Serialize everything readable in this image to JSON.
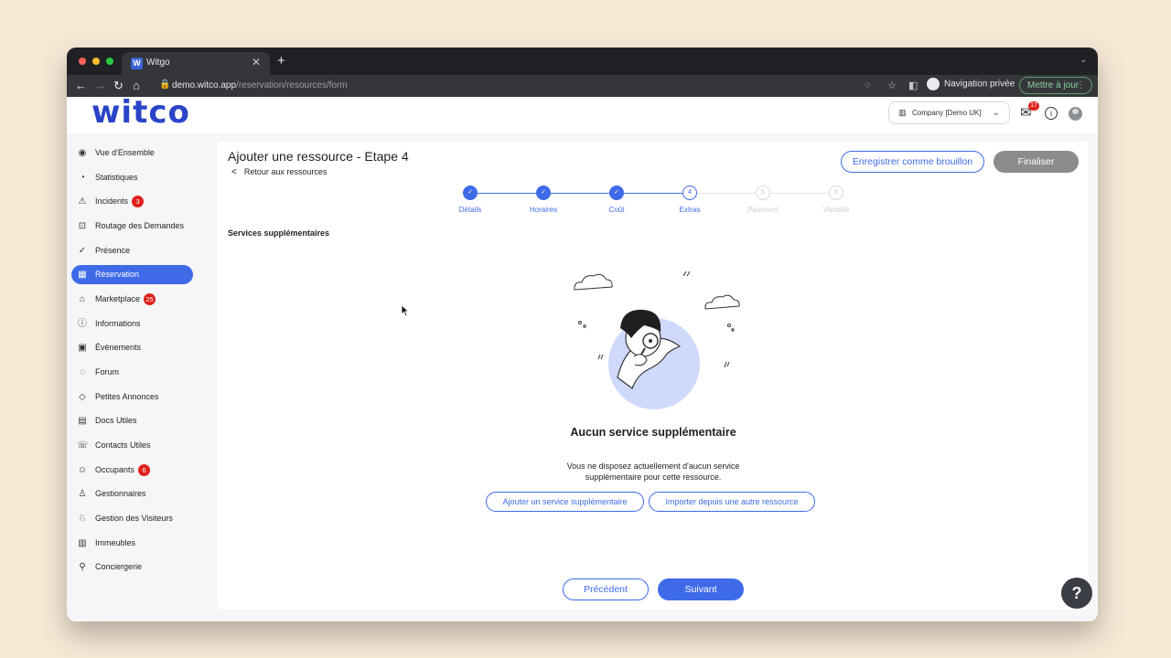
{
  "browser": {
    "tab_title": "Witgo",
    "tab_favicon": "W",
    "url_host": "demo.witco.app",
    "url_path": "/reservation/resources/form",
    "private_label": "Navigation privée",
    "update_label": "Mettre à jour"
  },
  "header": {
    "logo": "witco",
    "company": "Company [Demo UK]",
    "mail_badge": "17"
  },
  "sidebar": {
    "items": [
      {
        "label": "Vue d'Ensemble",
        "icon": "eye-icon",
        "glyph": "◉"
      },
      {
        "label": "Statistiques",
        "icon": "pie-chart-icon",
        "glyph": "◔"
      },
      {
        "label": "Incidents",
        "icon": "warning-icon",
        "glyph": "⚠",
        "badge": "3"
      },
      {
        "label": "Routage des Demandes",
        "icon": "routing-icon",
        "glyph": "⊡"
      },
      {
        "label": "Présence",
        "icon": "check-circle-icon",
        "glyph": "✓"
      },
      {
        "label": "Réservation",
        "icon": "calendar-icon",
        "glyph": "▦",
        "active": true
      },
      {
        "label": "Marketplace",
        "icon": "store-icon",
        "glyph": "⌂",
        "badge": "25"
      },
      {
        "label": "Informations",
        "icon": "info-icon",
        "glyph": "ⓘ"
      },
      {
        "label": "Évènements",
        "icon": "event-icon",
        "glyph": "▣"
      },
      {
        "label": "Forum",
        "icon": "forum-icon",
        "glyph": "◌"
      },
      {
        "label": "Petites Annonces",
        "icon": "tag-icon",
        "glyph": "◇"
      },
      {
        "label": "Docs Utiles",
        "icon": "document-icon",
        "glyph": "▤"
      },
      {
        "label": "Contacts Utiles",
        "icon": "phone-icon",
        "glyph": "☏"
      },
      {
        "label": "Occupants",
        "icon": "users-icon",
        "glyph": "☺",
        "badge": "6"
      },
      {
        "label": "Gestionnaires",
        "icon": "user-icon",
        "glyph": "♙"
      },
      {
        "label": "Gestion des Visiteurs",
        "icon": "visitor-icon",
        "glyph": "♘"
      },
      {
        "label": "Immeubles",
        "icon": "building-icon",
        "glyph": "▥"
      },
      {
        "label": "Conciergerie",
        "icon": "concierge-icon",
        "glyph": "⚲"
      }
    ]
  },
  "page": {
    "title": "Ajouter une ressource - Etape 4",
    "back_label": "Retour aux ressources",
    "draft_label": "Enregistrer comme brouillon",
    "finalize_label": "Finaliser",
    "section_title": "Services supplémentaires",
    "steps": [
      {
        "label": "Détails",
        "state": "done"
      },
      {
        "label": "Horaires",
        "state": "done"
      },
      {
        "label": "Coût",
        "state": "done"
      },
      {
        "label": "Extras",
        "state": "current",
        "num": "4"
      },
      {
        "label": "Paiement",
        "state": "future",
        "num": "5"
      },
      {
        "label": "Visibilité",
        "state": "future",
        "num": "6"
      }
    ],
    "empty_title": "Aucun service supplémentaire",
    "empty_desc": "Vous ne disposez actuellement d'aucun service supplémentaire pour cette ressource.",
    "add_service_label": "Ajouter un service supplémentaire",
    "import_label": "Importer depuis une autre ressource",
    "prev_label": "Précédent",
    "next_label": "Suivant"
  },
  "help_label": "?",
  "colors": {
    "accent": "#3e6ae8",
    "badge": "#e0201b",
    "finalize_disabled": "#8c8c8c"
  }
}
